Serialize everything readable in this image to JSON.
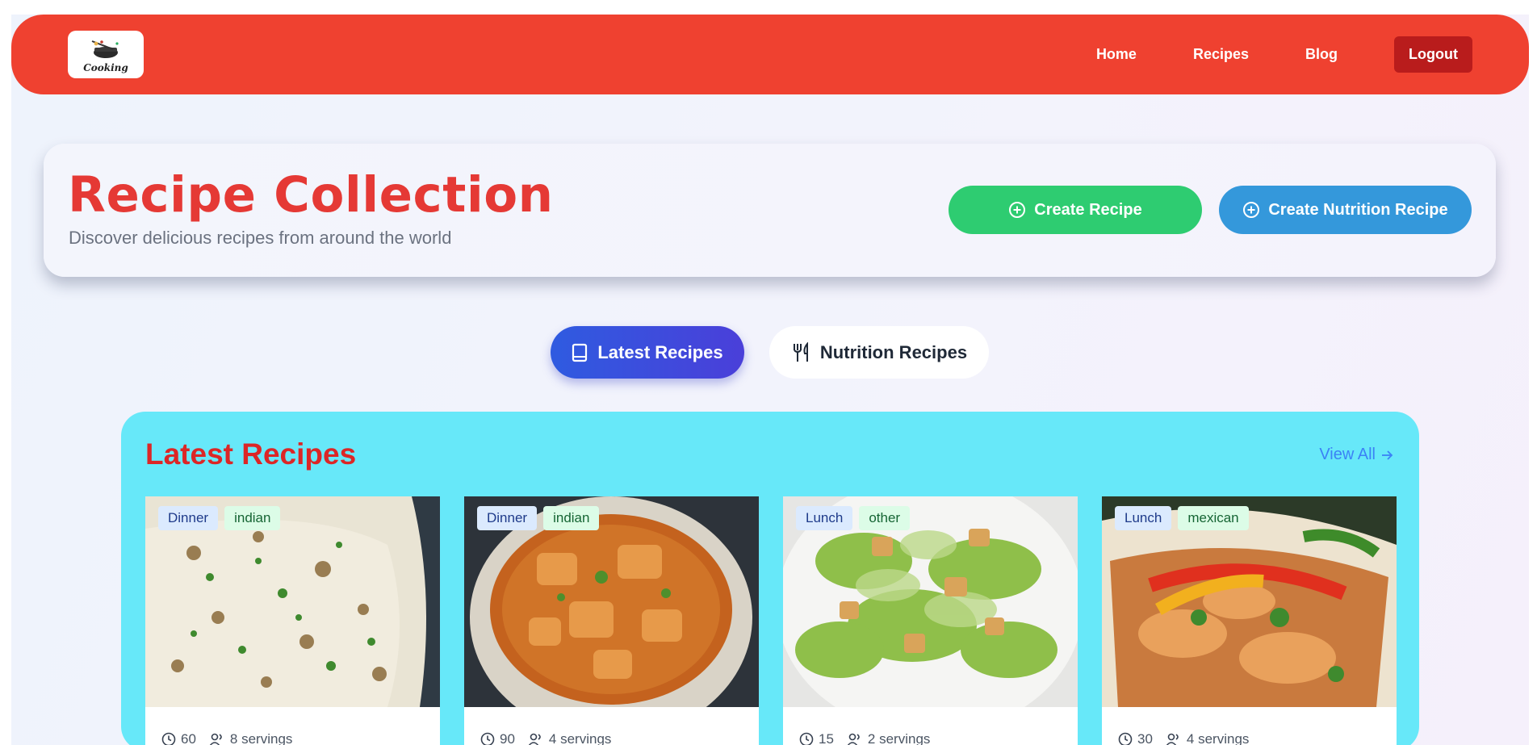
{
  "nav": {
    "logo_text": "Cooking",
    "links": [
      "Home",
      "Recipes",
      "Blog"
    ],
    "logout_label": "Logout"
  },
  "hero": {
    "title": "Recipe Collection",
    "subtitle": "Discover delicious recipes from around the world",
    "create_recipe_label": "Create Recipe",
    "create_nutrition_label": "Create Nutrition Recipe"
  },
  "tabs": {
    "latest_label": "Latest Recipes",
    "nutrition_label": "Nutrition Recipes"
  },
  "section": {
    "title": "Latest Recipes",
    "view_all_label": "View All"
  },
  "cards": [
    {
      "meal": "Dinner",
      "cuisine": "indian",
      "time": "60",
      "servings": "8 servings"
    },
    {
      "meal": "Dinner",
      "cuisine": "indian",
      "time": "90",
      "servings": "4 servings"
    },
    {
      "meal": "Lunch",
      "cuisine": "other",
      "time": "15",
      "servings": "2 servings"
    },
    {
      "meal": "Lunch",
      "cuisine": "mexican",
      "time": "30",
      "servings": "4 servings"
    }
  ],
  "colors": {
    "navbar": "#ef4130",
    "logout": "#b91c1c",
    "title_red": "#e53935",
    "create_green": "#2ecc71",
    "create_blue": "#3498db",
    "tab_active": "#2f5be0",
    "panel_cyan": "#67e8f9"
  }
}
